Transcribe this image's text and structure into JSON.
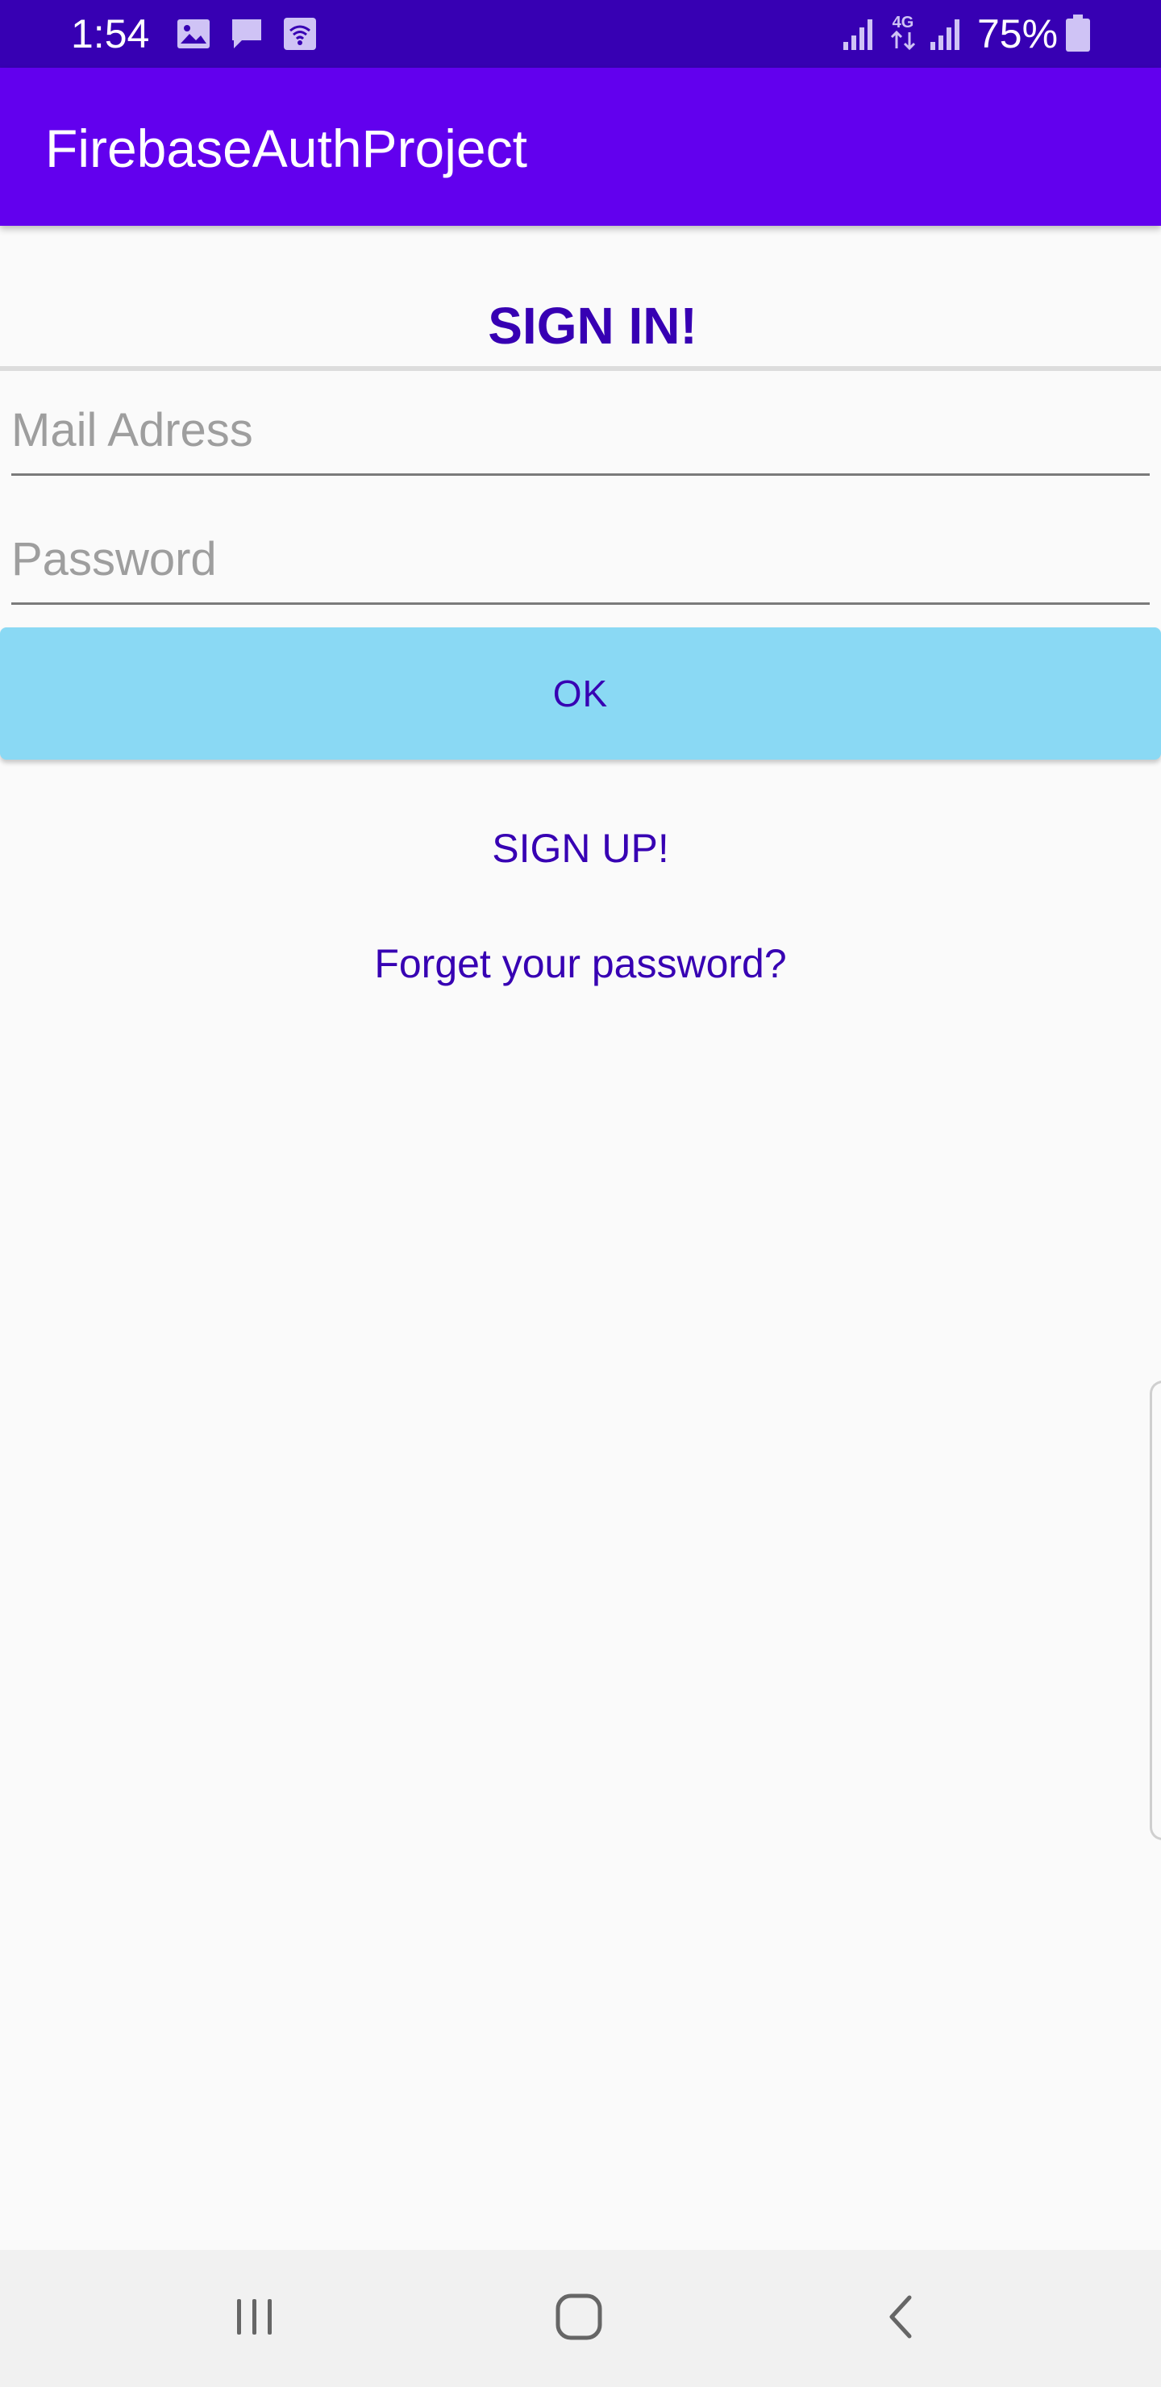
{
  "status_bar": {
    "time": "1:54",
    "battery_text": "75%",
    "network_label": "4G",
    "left_icons": [
      "gallery-icon",
      "message-icon",
      "wifi-calling-icon"
    ],
    "right_icons": [
      "signal-icon",
      "data-arrows-icon",
      "signal-icon",
      "battery-icon"
    ]
  },
  "app_bar": {
    "title": "FirebaseAuthProject"
  },
  "signin": {
    "title": "SIGN IN!"
  },
  "form": {
    "mail_placeholder": "Mail Adress",
    "mail_value": "",
    "password_placeholder": "Password",
    "password_value": "",
    "ok_label": "OK"
  },
  "links": {
    "signup": "SIGN UP!",
    "forgot": "Forget your password?"
  },
  "nav_bar": {
    "buttons": [
      "recent-apps-icon",
      "home-icon",
      "back-icon"
    ]
  },
  "colors": {
    "status_bar": "#3700b3",
    "app_bar": "#6200ee",
    "accent_text": "#3700b3",
    "button_bg": "#8ad9f4",
    "background": "#fafafa",
    "nav_bar": "#f1f1f1"
  }
}
